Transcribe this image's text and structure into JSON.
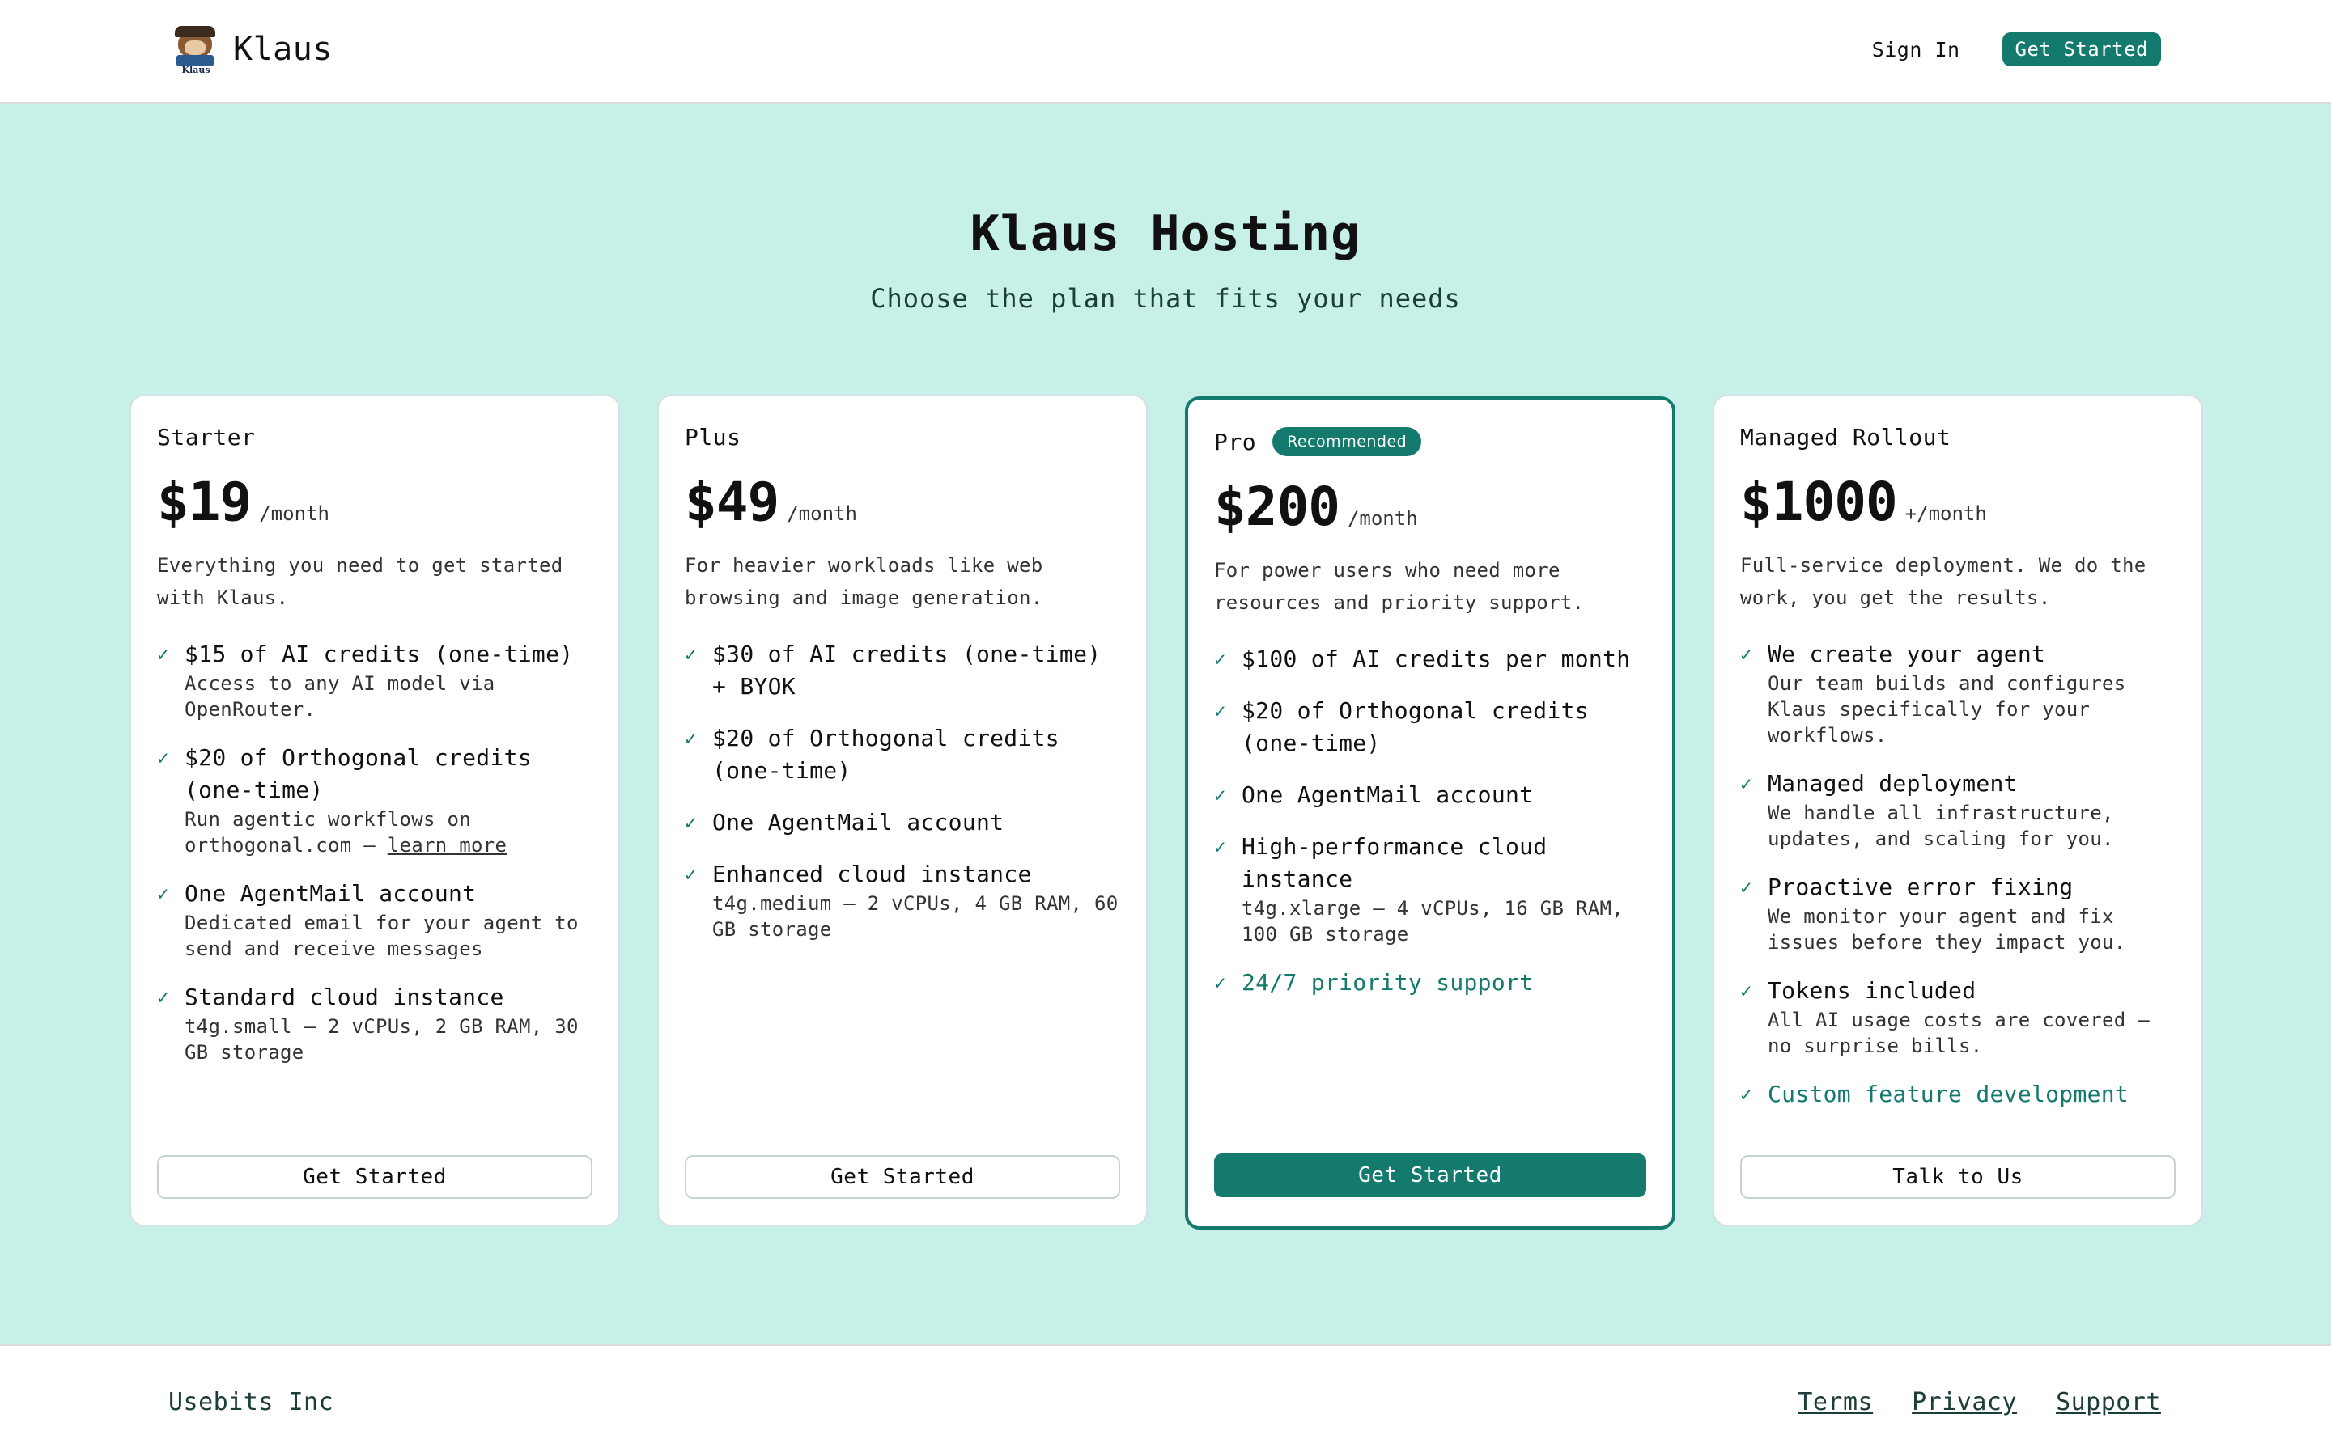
{
  "header": {
    "brand_name": "Klaus",
    "logo_tag": "Klaus",
    "sign_in": "Sign In",
    "get_started": "Get Started"
  },
  "hero": {
    "title": "Klaus Hosting",
    "subtitle": "Choose the plan that fits your needs"
  },
  "plans": [
    {
      "name": "Starter",
      "price": "$19",
      "period": "/month",
      "description": "Everything you need to get started with Klaus.",
      "features": [
        {
          "title": "$15 of AI credits (one-time)",
          "sub": "Access to any AI model via OpenRouter."
        },
        {
          "title": "$20 of Orthogonal credits (one-time)",
          "sub": "Run agentic workflows on orthogonal.com — ",
          "link": "learn more"
        },
        {
          "title": "One AgentMail account",
          "sub": "Dedicated email for your agent to send and receive messages"
        },
        {
          "title": "Standard cloud instance",
          "sub": "t4g.small — 2 vCPUs, 2 GB RAM, 30 GB storage"
        }
      ],
      "button": "Get Started"
    },
    {
      "name": "Plus",
      "price": "$49",
      "period": "/month",
      "description": "For heavier workloads like web browsing and image generation.",
      "features": [
        {
          "title": "$30 of AI credits (one-time) + BYOK"
        },
        {
          "title": "$20 of Orthogonal credits (one-time)"
        },
        {
          "title": "One AgentMail account"
        },
        {
          "title": "Enhanced cloud instance",
          "sub": "t4g.medium — 2 vCPUs, 4 GB RAM, 60 GB storage"
        }
      ],
      "button": "Get Started"
    },
    {
      "name": "Pro",
      "badge": "Recommended",
      "price": "$200",
      "period": "/month",
      "description": "For power users who need more resources and priority support.",
      "features": [
        {
          "title": "$100 of AI credits per month"
        },
        {
          "title": "$20 of Orthogonal credits (one-time)"
        },
        {
          "title": "One AgentMail account"
        },
        {
          "title": "High-performance cloud instance",
          "sub": "t4g.xlarge — 4 vCPUs, 16 GB RAM, 100 GB storage"
        },
        {
          "title": "24/7 priority support",
          "accent": true
        }
      ],
      "button": "Get Started"
    },
    {
      "name": "Managed Rollout",
      "price": "$1000",
      "period": "+/month",
      "description": "Full-service deployment. We do the work, you get the results.",
      "features": [
        {
          "title": "We create your agent",
          "sub": "Our team builds and configures Klaus specifically for your workflows."
        },
        {
          "title": "Managed deployment",
          "sub": "We handle all infrastructure, updates, and scaling for you."
        },
        {
          "title": "Proactive error fixing",
          "sub": "We monitor your agent and fix issues before they impact you."
        },
        {
          "title": "Tokens included",
          "sub": "All AI usage costs are covered — no surprise bills."
        },
        {
          "title": "Custom feature development",
          "accent": true
        }
      ],
      "button": "Talk to Us"
    }
  ],
  "check_glyph": "✓",
  "footer": {
    "company": "Usebits Inc",
    "links": [
      "Terms",
      "Privacy",
      "Support"
    ]
  },
  "colors": {
    "accent": "#147a6e",
    "background": "#c7f0e9"
  }
}
